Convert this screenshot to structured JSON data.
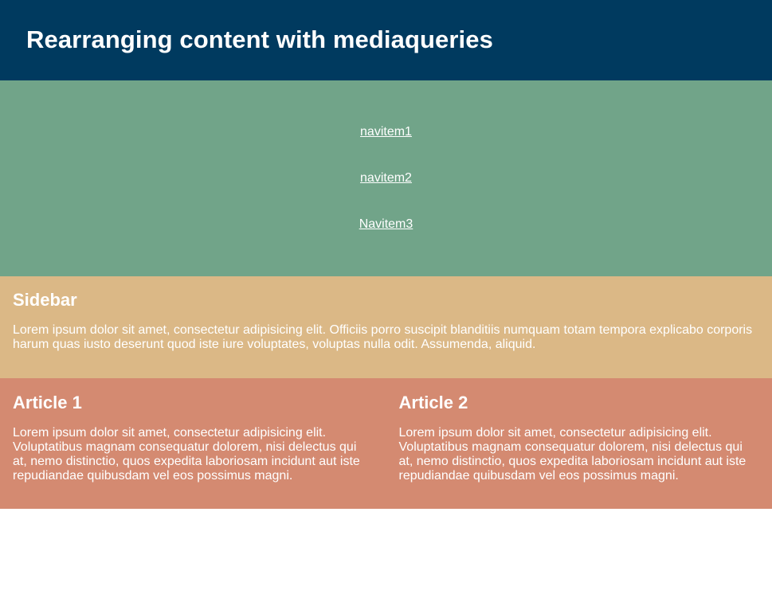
{
  "header": {
    "title": "Rearranging content with mediaqueries"
  },
  "nav": {
    "items": [
      {
        "label": "navitem1"
      },
      {
        "label": "navitem2"
      },
      {
        "label": "Navitem3"
      }
    ]
  },
  "sidebar": {
    "heading": "Sidebar",
    "text": "Lorem ipsum dolor sit amet, consectetur adipisicing elit. Officiis porro suscipit blanditiis numquam totam tempora explicabo corporis harum quas iusto deserunt quod iste iure voluptates, voluptas nulla odit. Assumenda, aliquid."
  },
  "articles": [
    {
      "heading": "Article 1",
      "text": "Lorem ipsum dolor sit amet, consectetur adipisicing elit. Voluptatibus magnam consequatur dolorem, nisi delectus qui at, nemo distinctio, quos expedita laboriosam incidunt aut iste repudiandae quibusdam vel eos possimus magni."
    },
    {
      "heading": "Article 2",
      "text": "Lorem ipsum dolor sit amet, consectetur adipisicing elit. Voluptatibus magnam consequatur dolorem, nisi delectus qui at, nemo distinctio, quos expedita laboriosam incidunt aut iste repudiandae quibusdam vel eos possimus magni."
    }
  ],
  "colors": {
    "header_bg": "#003a5f",
    "nav_bg": "#71a489",
    "sidebar_bg": "#dbb886",
    "articles_bg": "#d48a71",
    "text": "#ffffff"
  }
}
